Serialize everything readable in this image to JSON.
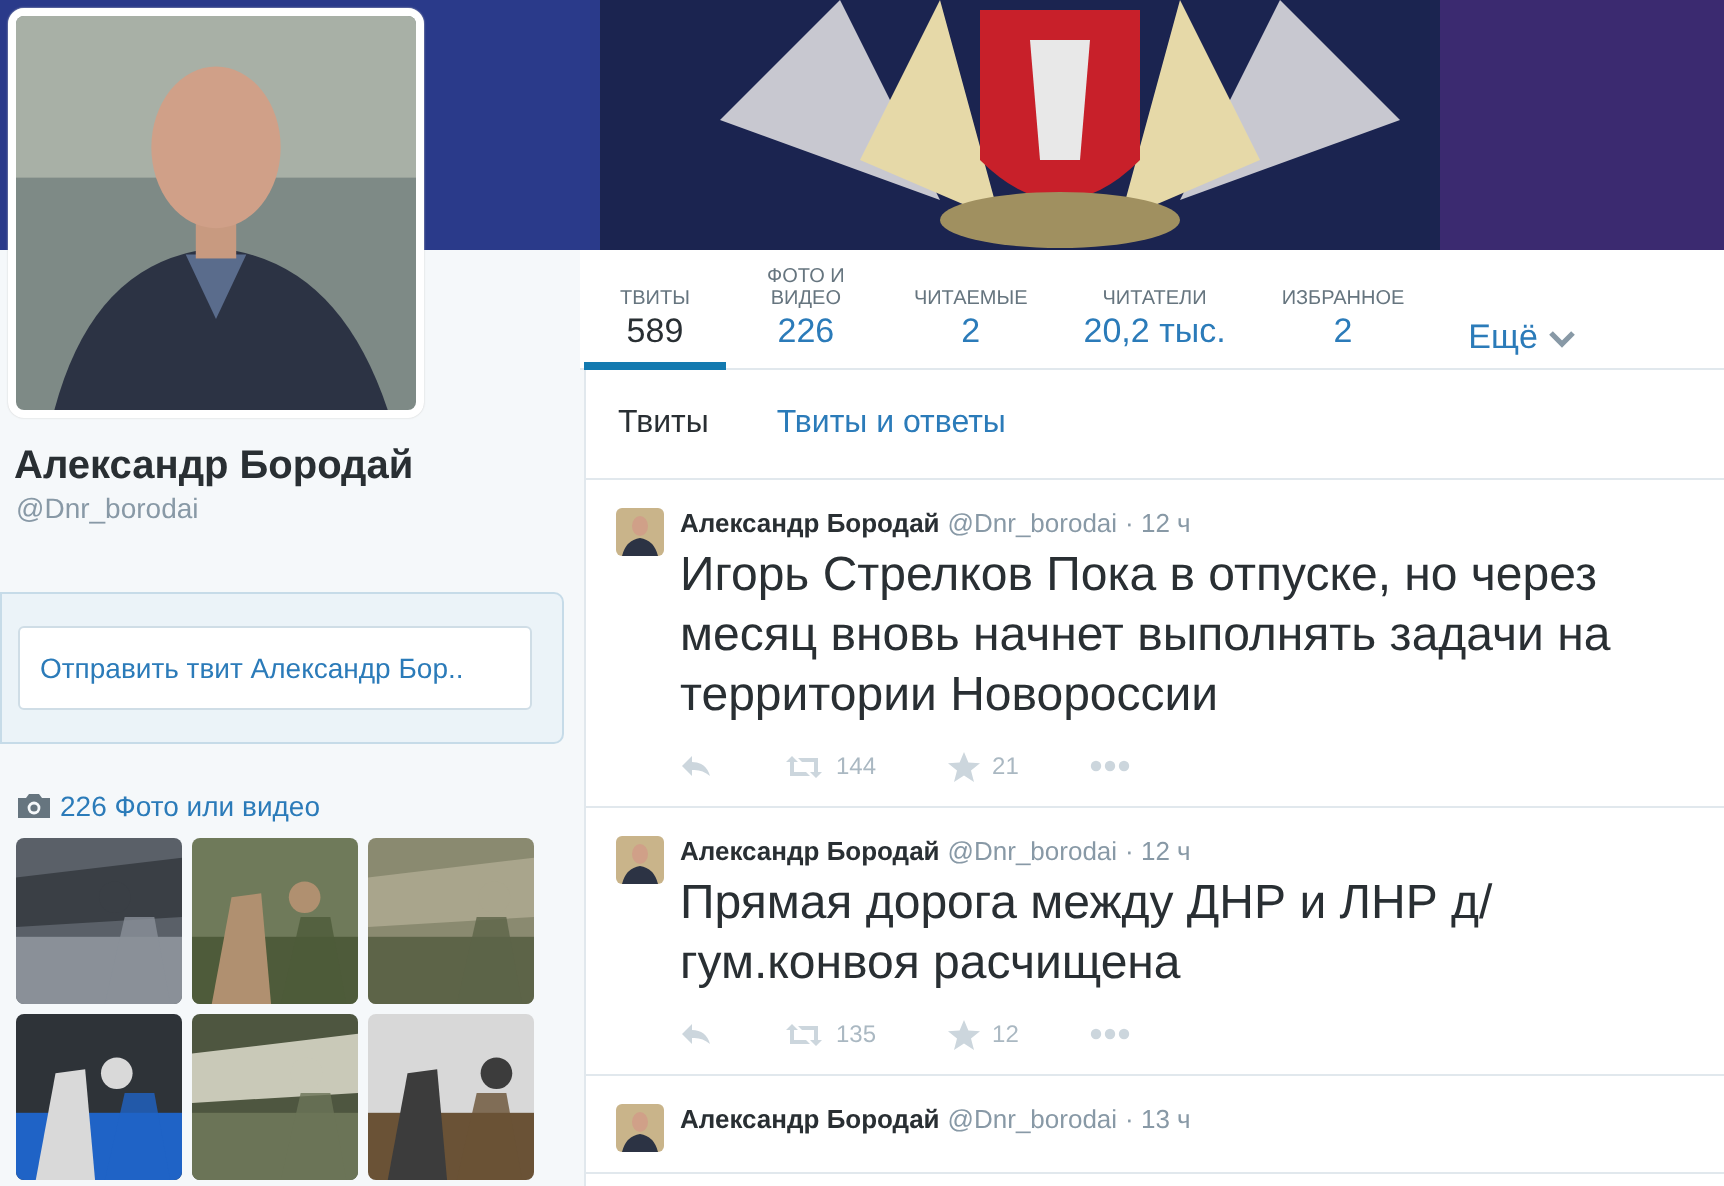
{
  "profile": {
    "name": "Александр Бородай",
    "handle": "@Dnr_borodai"
  },
  "tweet_box": {
    "placeholder": "Отправить твит Александр Бор.."
  },
  "photos": {
    "label": "226 Фото или видео"
  },
  "stats": [
    {
      "label": "ТВИТЫ",
      "value": "589",
      "selected": true
    },
    {
      "label": "ФОТО И ВИДЕО",
      "value": "226",
      "selected": false
    },
    {
      "label": "ЧИТАЕМЫЕ",
      "value": "2",
      "selected": false
    },
    {
      "label": "ЧИТАТЕЛИ",
      "value": "20,2 тыс.",
      "selected": false
    },
    {
      "label": "ИЗБРАННОЕ",
      "value": "2",
      "selected": false
    }
  ],
  "more": "Ещё",
  "tabs": [
    {
      "label": "Твиты",
      "selected": true
    },
    {
      "label": "Твиты и ответы",
      "selected": false
    }
  ],
  "tweets": [
    {
      "name": "Александр Бородай",
      "handle": "@Dnr_borodai",
      "time": "· 12 ч",
      "text": "Игорь Стрелков Пока в отпуске, но через месяц вновь начнет выполнять задачи на территории Новороссии",
      "retweets": "144",
      "favorites": "21"
    },
    {
      "name": "Александр Бородай",
      "handle": "@Dnr_borodai",
      "time": "· 12 ч",
      "text": "Прямая дорога между ДНР и ЛНР д/ гум.конвоя расчищена",
      "retweets": "135",
      "favorites": "12"
    },
    {
      "name": "Александр Бородай",
      "handle": "@Dnr_borodai",
      "time": "· 13 ч"
    }
  ]
}
